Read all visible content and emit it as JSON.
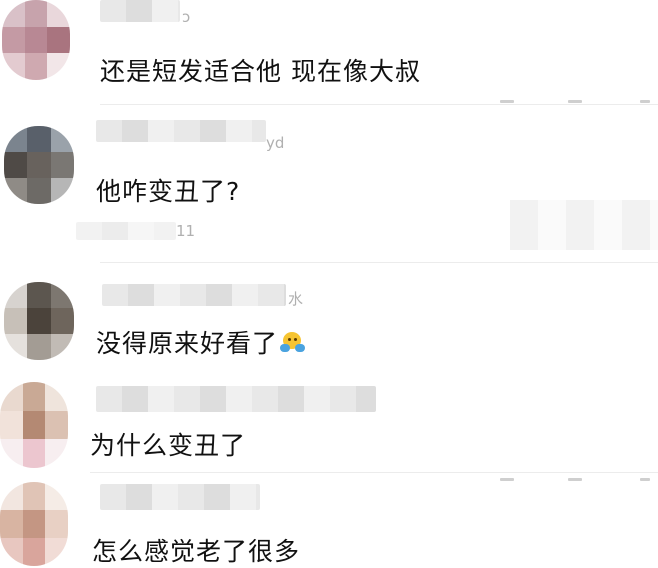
{
  "comments": [
    {
      "username_tail": "ɔ",
      "text": "还是短发适合他 现在像大叔"
    },
    {
      "username_tail": "yd",
      "text": "他咋变丑了?"
    },
    {
      "username_tail": "11",
      "text": ""
    },
    {
      "username_tail": "水",
      "text": "没得原来好看了"
    },
    {
      "username_tail": "",
      "text": "为什么变丑了"
    },
    {
      "username_tail": "",
      "text": "怎么感觉老了很多"
    }
  ],
  "emoji_icon": "shrug-emoji-icon"
}
